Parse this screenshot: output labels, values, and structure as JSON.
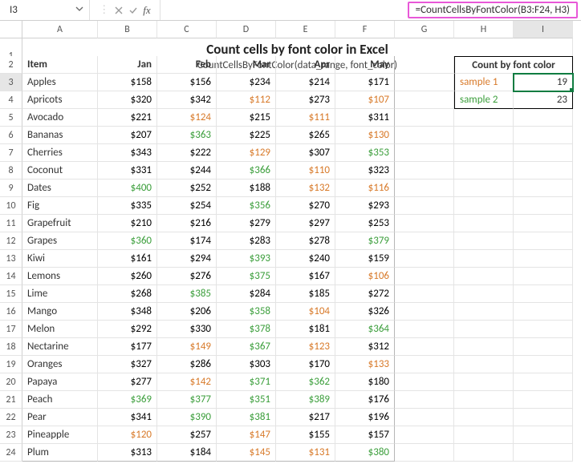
{
  "namebox": {
    "value": "I3"
  },
  "formula": "=CountCellsByFontColor(B3:F24, H3)",
  "columns": [
    "A",
    "B",
    "C",
    "D",
    "E",
    "F",
    "G",
    "H",
    "I"
  ],
  "selected": {
    "col": "I",
    "row": 3
  },
  "title": {
    "big": "Count cells by font color in Excel",
    "sub": "CountCellsByFontColor(data_range, font_color)"
  },
  "headers": [
    "Item",
    "Jan",
    "Feb",
    "Mar",
    "Apr",
    "May"
  ],
  "rows": [
    {
      "r": 3,
      "item": "Apples",
      "v": [
        {
          "t": "$158",
          "c": "black"
        },
        {
          "t": "$156",
          "c": "black"
        },
        {
          "t": "$234",
          "c": "black"
        },
        {
          "t": "$214",
          "c": "black"
        },
        {
          "t": "$171",
          "c": "black"
        }
      ]
    },
    {
      "r": 4,
      "item": "Apricots",
      "v": [
        {
          "t": "$320",
          "c": "black"
        },
        {
          "t": "$342",
          "c": "black"
        },
        {
          "t": "$112",
          "c": "orange"
        },
        {
          "t": "$273",
          "c": "black"
        },
        {
          "t": "$107",
          "c": "orange"
        }
      ]
    },
    {
      "r": 5,
      "item": "Avocado",
      "v": [
        {
          "t": "$221",
          "c": "black"
        },
        {
          "t": "$124",
          "c": "orange"
        },
        {
          "t": "$215",
          "c": "black"
        },
        {
          "t": "$111",
          "c": "orange"
        },
        {
          "t": "$311",
          "c": "black"
        }
      ]
    },
    {
      "r": 6,
      "item": "Bananas",
      "v": [
        {
          "t": "$207",
          "c": "black"
        },
        {
          "t": "$363",
          "c": "green"
        },
        {
          "t": "$225",
          "c": "black"
        },
        {
          "t": "$265",
          "c": "black"
        },
        {
          "t": "$130",
          "c": "orange"
        }
      ]
    },
    {
      "r": 7,
      "item": "Cherries",
      "v": [
        {
          "t": "$343",
          "c": "black"
        },
        {
          "t": "$222",
          "c": "black"
        },
        {
          "t": "$129",
          "c": "orange"
        },
        {
          "t": "$307",
          "c": "black"
        },
        {
          "t": "$353",
          "c": "green"
        }
      ]
    },
    {
      "r": 8,
      "item": "Coconut",
      "v": [
        {
          "t": "$331",
          "c": "black"
        },
        {
          "t": "$244",
          "c": "black"
        },
        {
          "t": "$366",
          "c": "green"
        },
        {
          "t": "$110",
          "c": "orange"
        },
        {
          "t": "$323",
          "c": "black"
        }
      ]
    },
    {
      "r": 9,
      "item": "Dates",
      "v": [
        {
          "t": "$400",
          "c": "green"
        },
        {
          "t": "$252",
          "c": "black"
        },
        {
          "t": "$188",
          "c": "black"
        },
        {
          "t": "$132",
          "c": "orange"
        },
        {
          "t": "$116",
          "c": "orange"
        }
      ]
    },
    {
      "r": 10,
      "item": "Fig",
      "v": [
        {
          "t": "$335",
          "c": "black"
        },
        {
          "t": "$254",
          "c": "black"
        },
        {
          "t": "$356",
          "c": "green"
        },
        {
          "t": "$270",
          "c": "black"
        },
        {
          "t": "$293",
          "c": "black"
        }
      ]
    },
    {
      "r": 11,
      "item": "Grapefruit",
      "v": [
        {
          "t": "$210",
          "c": "black"
        },
        {
          "t": "$216",
          "c": "black"
        },
        {
          "t": "$279",
          "c": "black"
        },
        {
          "t": "$297",
          "c": "black"
        },
        {
          "t": "$253",
          "c": "black"
        }
      ]
    },
    {
      "r": 12,
      "item": "Grapes",
      "v": [
        {
          "t": "$360",
          "c": "green"
        },
        {
          "t": "$174",
          "c": "black"
        },
        {
          "t": "$283",
          "c": "black"
        },
        {
          "t": "$278",
          "c": "black"
        },
        {
          "t": "$379",
          "c": "green"
        }
      ]
    },
    {
      "r": 13,
      "item": "Kiwi",
      "v": [
        {
          "t": "$161",
          "c": "black"
        },
        {
          "t": "$294",
          "c": "black"
        },
        {
          "t": "$393",
          "c": "green"
        },
        {
          "t": "$240",
          "c": "black"
        },
        {
          "t": "$159",
          "c": "black"
        }
      ]
    },
    {
      "r": 14,
      "item": "Lemons",
      "v": [
        {
          "t": "$260",
          "c": "black"
        },
        {
          "t": "$276",
          "c": "black"
        },
        {
          "t": "$375",
          "c": "green"
        },
        {
          "t": "$167",
          "c": "black"
        },
        {
          "t": "$106",
          "c": "orange"
        }
      ]
    },
    {
      "r": 15,
      "item": "Lime",
      "v": [
        {
          "t": "$268",
          "c": "black"
        },
        {
          "t": "$385",
          "c": "green"
        },
        {
          "t": "$284",
          "c": "black"
        },
        {
          "t": "$185",
          "c": "black"
        },
        {
          "t": "$272",
          "c": "black"
        }
      ]
    },
    {
      "r": 16,
      "item": "Mango",
      "v": [
        {
          "t": "$348",
          "c": "black"
        },
        {
          "t": "$206",
          "c": "black"
        },
        {
          "t": "$358",
          "c": "green"
        },
        {
          "t": "$104",
          "c": "orange"
        },
        {
          "t": "$326",
          "c": "black"
        }
      ]
    },
    {
      "r": 17,
      "item": "Melon",
      "v": [
        {
          "t": "$292",
          "c": "black"
        },
        {
          "t": "$330",
          "c": "black"
        },
        {
          "t": "$378",
          "c": "green"
        },
        {
          "t": "$181",
          "c": "black"
        },
        {
          "t": "$364",
          "c": "green"
        }
      ]
    },
    {
      "r": 18,
      "item": "Nectarine",
      "v": [
        {
          "t": "$177",
          "c": "black"
        },
        {
          "t": "$149",
          "c": "orange"
        },
        {
          "t": "$367",
          "c": "green"
        },
        {
          "t": "$123",
          "c": "orange"
        },
        {
          "t": "$312",
          "c": "black"
        }
      ]
    },
    {
      "r": 19,
      "item": "Oranges",
      "v": [
        {
          "t": "$327",
          "c": "black"
        },
        {
          "t": "$286",
          "c": "black"
        },
        {
          "t": "$303",
          "c": "black"
        },
        {
          "t": "$170",
          "c": "black"
        },
        {
          "t": "$133",
          "c": "orange"
        }
      ]
    },
    {
      "r": 20,
      "item": "Papaya",
      "v": [
        {
          "t": "$277",
          "c": "black"
        },
        {
          "t": "$142",
          "c": "orange"
        },
        {
          "t": "$371",
          "c": "green"
        },
        {
          "t": "$362",
          "c": "green"
        },
        {
          "t": "$180",
          "c": "black"
        }
      ]
    },
    {
      "r": 21,
      "item": "Peach",
      "v": [
        {
          "t": "$369",
          "c": "green"
        },
        {
          "t": "$377",
          "c": "green"
        },
        {
          "t": "$351",
          "c": "green"
        },
        {
          "t": "$389",
          "c": "green"
        },
        {
          "t": "$176",
          "c": "black"
        }
      ]
    },
    {
      "r": 22,
      "item": "Pear",
      "v": [
        {
          "t": "$341",
          "c": "black"
        },
        {
          "t": "$390",
          "c": "green"
        },
        {
          "t": "$381",
          "c": "green"
        },
        {
          "t": "$217",
          "c": "black"
        },
        {
          "t": "$196",
          "c": "black"
        }
      ]
    },
    {
      "r": 23,
      "item": "Pineapple",
      "v": [
        {
          "t": "$120",
          "c": "orange"
        },
        {
          "t": "$257",
          "c": "black"
        },
        {
          "t": "$147",
          "c": "orange"
        },
        {
          "t": "$155",
          "c": "black"
        },
        {
          "t": "$157",
          "c": "black"
        }
      ]
    },
    {
      "r": 24,
      "item": "Plum",
      "v": [
        {
          "t": "$313",
          "c": "black"
        },
        {
          "t": "$184",
          "c": "black"
        },
        {
          "t": "$145",
          "c": "orange"
        },
        {
          "t": "$131",
          "c": "orange"
        },
        {
          "t": "$380",
          "c": "green"
        }
      ]
    }
  ],
  "countbox": {
    "title": "Count by font color",
    "items": [
      {
        "row": 3,
        "label": "sample 1",
        "labelColor": "orange",
        "value": "19"
      },
      {
        "row": 4,
        "label": "sample 2",
        "labelColor": "green",
        "value": "23"
      }
    ]
  }
}
